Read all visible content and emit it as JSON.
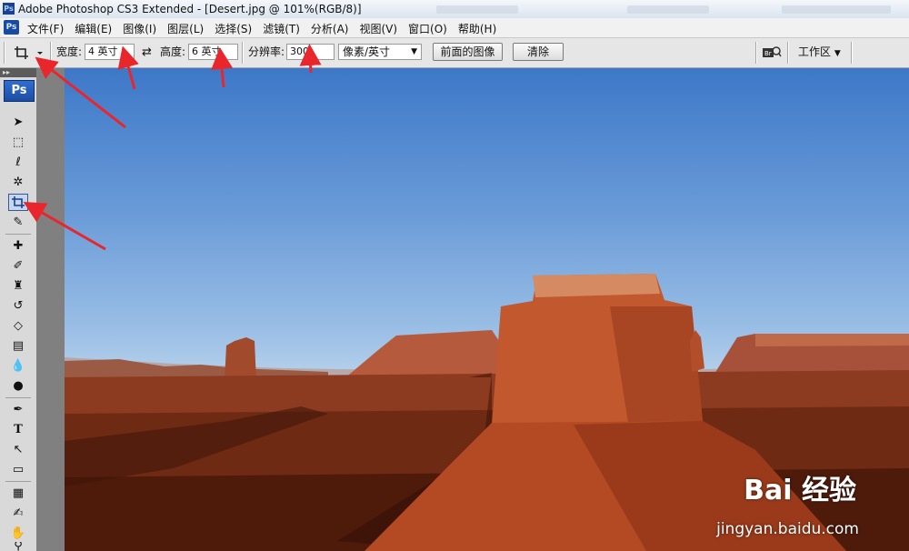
{
  "window": {
    "title": "Adobe Photoshop CS3 Extended - [Desert.jpg @ 101%(RGB/8)]",
    "app_icon": "Ps"
  },
  "menu": [
    "文件(F)",
    "编辑(E)",
    "图像(I)",
    "图层(L)",
    "选择(S)",
    "滤镜(T)",
    "分析(A)",
    "视图(V)",
    "窗口(O)",
    "帮助(H)"
  ],
  "options": {
    "width_label": "宽度:",
    "width_value": "4 英寸",
    "height_label": "高度:",
    "height_value": "6 英寸",
    "resolution_label": "分辨率:",
    "resolution_value": "300",
    "resolution_unit": "像素/英寸",
    "front_image_button": "前面的图像",
    "clear_button": "清除",
    "workspace_label": "工作区"
  },
  "toolbox": {
    "logo": "Ps",
    "tools": [
      "move",
      "marquee",
      "lasso",
      "magic-wand",
      "crop",
      "slice",
      "healing-brush",
      "brush",
      "clone-stamp",
      "history-brush",
      "eraser",
      "gradient",
      "blur",
      "dodge",
      "pen",
      "type",
      "path-selection",
      "shape",
      "notes",
      "eyedropper",
      "hand",
      "zoom"
    ],
    "active_tool": "crop"
  },
  "watermark": {
    "main": "Bai 经验",
    "sub": "jingyan.baidu.com"
  },
  "colors": {
    "annotation_arrow": "#e8262b",
    "ps_blue": "#1b4da4"
  }
}
